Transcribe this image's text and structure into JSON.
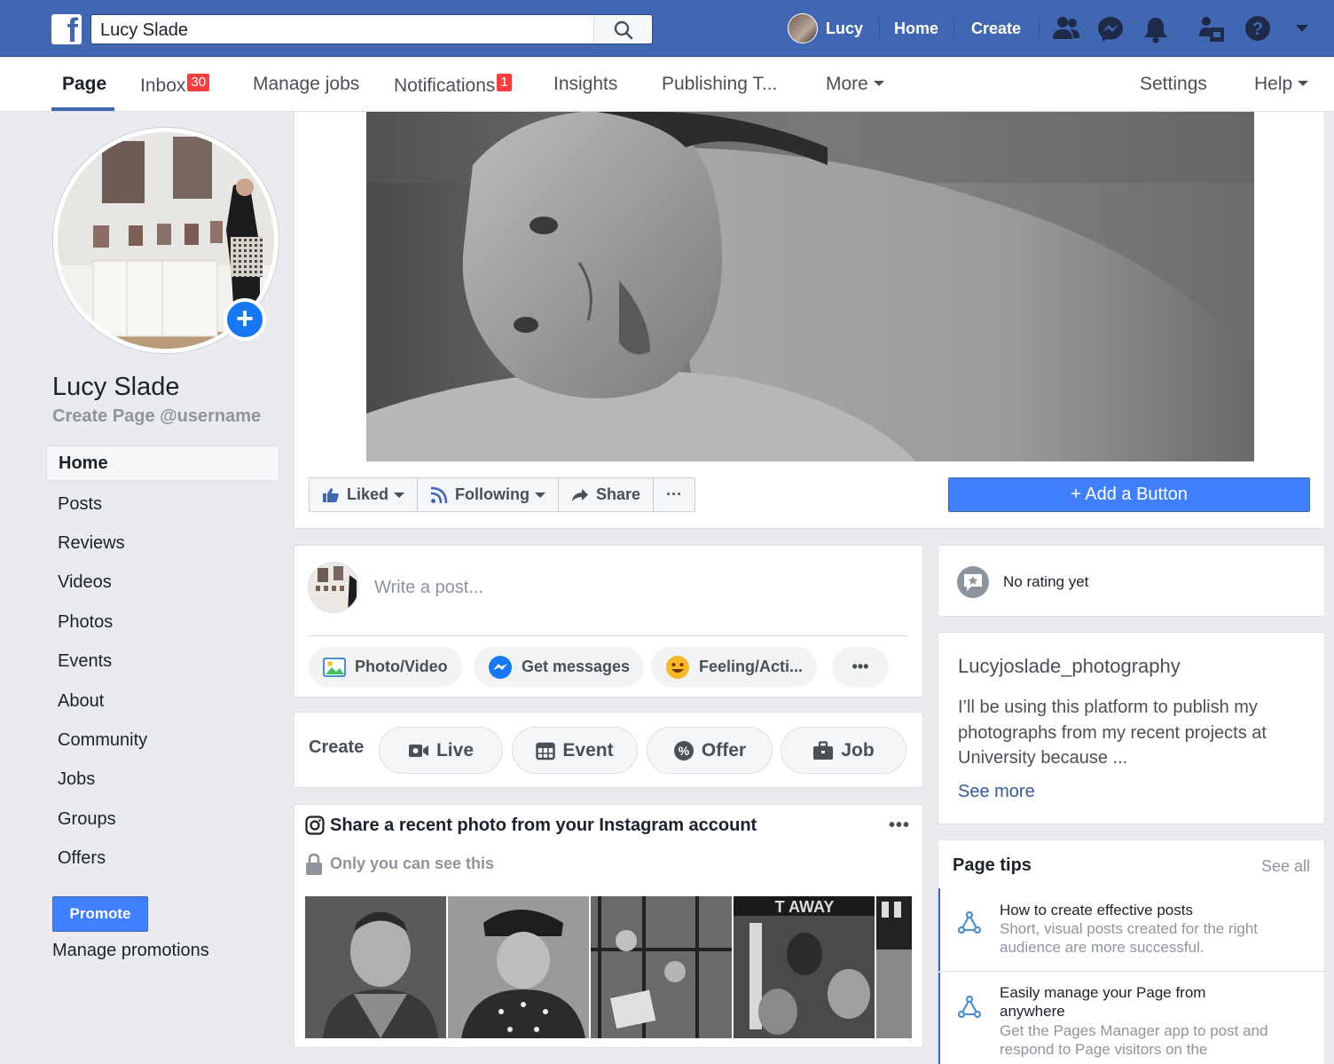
{
  "topbar": {
    "logo": "f",
    "search_value": "Lucy Slade",
    "user_name": "Lucy",
    "home_label": "Home",
    "create_label": "Create",
    "icons": [
      "friends-icon",
      "messenger-icon",
      "bell-icon",
      "page-switch-icon",
      "help-icon",
      "caret-down-icon"
    ],
    "brand_color": "#4267b2"
  },
  "page_tabs": {
    "page": "Page",
    "inbox": "Inbox",
    "inbox_count": "30",
    "manage_jobs": "Manage jobs",
    "notifications": "Notifications",
    "notifications_count": "1",
    "insights": "Insights",
    "publishing": "Publishing T...",
    "more": "More",
    "settings": "Settings",
    "help": "Help"
  },
  "profile": {
    "name": "Lucy Slade",
    "username_prompt": "Create Page @username",
    "add_photo": "+"
  },
  "sidebar": {
    "items": [
      {
        "label": "Home"
      },
      {
        "label": "Posts"
      },
      {
        "label": "Reviews"
      },
      {
        "label": "Videos"
      },
      {
        "label": "Photos"
      },
      {
        "label": "Events"
      },
      {
        "label": "About"
      },
      {
        "label": "Community"
      },
      {
        "label": "Jobs"
      },
      {
        "label": "Groups"
      },
      {
        "label": "Offers"
      }
    ],
    "promote": "Promote",
    "manage_promotions": "Manage promotions"
  },
  "actions": {
    "liked": "Liked",
    "following": "Following",
    "share": "Share",
    "more": "···",
    "add_button": "+ Add a Button"
  },
  "composer": {
    "placeholder": "Write a post...",
    "photo_video": "Photo/Video",
    "get_messages": "Get messages",
    "feeling": "Feeling/Acti...",
    "more": "•••"
  },
  "create": {
    "label": "Create",
    "live": "Live",
    "event": "Event",
    "offer": "Offer",
    "job": "Job"
  },
  "instagram": {
    "title": "Share a recent photo from your Instagram account",
    "note": "Only you can see this",
    "more": "•••"
  },
  "rating": {
    "text": "No rating yet"
  },
  "about": {
    "title": "Lucyjoslade_photography",
    "description": "I’ll be using this platform to publish my photographs from my recent projects at University because ...",
    "see_more": "See more"
  },
  "tips": {
    "title": "Page tips",
    "see_all": "See all",
    "items": [
      {
        "title": "How to create effective posts",
        "body": "Short, visual posts created for the right audience are more successful."
      },
      {
        "title": "Easily manage your Page from anywhere",
        "body": "Get the Pages Manager app to post and respond to Page visitors on the"
      }
    ]
  }
}
